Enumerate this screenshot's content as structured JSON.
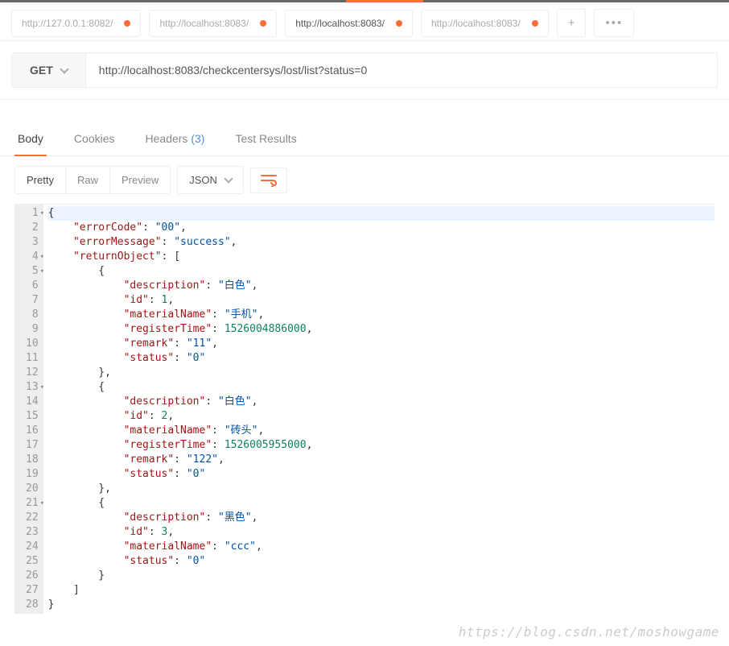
{
  "tabs": [
    {
      "label": "http://127.0.0.1:8082/",
      "dirty": true,
      "active": false
    },
    {
      "label": "http://localhost:8083/",
      "dirty": true,
      "active": false
    },
    {
      "label": "http://localhost:8083/",
      "dirty": true,
      "active": true
    },
    {
      "label": "http://localhost:8083/",
      "dirty": true,
      "active": false
    }
  ],
  "request": {
    "method": "GET",
    "url": "http://localhost:8083/checkcentersys/lost/list?status=0"
  },
  "response_tabs": {
    "body": "Body",
    "cookies": "Cookies",
    "headers": "Headers",
    "headers_count": "(3)",
    "test_results": "Test Results"
  },
  "view_toolbar": {
    "pretty": "Pretty",
    "raw": "Raw",
    "preview": "Preview",
    "format": "JSON"
  },
  "response_body": {
    "errorCode": "00",
    "errorMessage": "success",
    "returnObject": [
      {
        "description": "白色",
        "id": 1,
        "materialName": "手机",
        "registerTime": 1526004886000,
        "remark": "11",
        "status": "0"
      },
      {
        "description": "白色",
        "id": 2,
        "materialName": "砖头",
        "registerTime": 1526005955000,
        "remark": "122",
        "status": "0"
      },
      {
        "description": "黑色",
        "id": 3,
        "materialName": "ccc",
        "status": "0"
      }
    ]
  },
  "code_lines": [
    {
      "num": 1,
      "fold": true,
      "indent": 0,
      "tokens": [
        [
          "pun",
          "{"
        ]
      ],
      "hl": true
    },
    {
      "num": 2,
      "fold": false,
      "indent": 1,
      "tokens": [
        [
          "key",
          "\"errorCode\""
        ],
        [
          "pun",
          ": "
        ],
        [
          "str",
          "\"00\""
        ],
        [
          "pun",
          ","
        ]
      ]
    },
    {
      "num": 3,
      "fold": false,
      "indent": 1,
      "tokens": [
        [
          "key",
          "\"errorMessage\""
        ],
        [
          "pun",
          ": "
        ],
        [
          "str",
          "\"success\""
        ],
        [
          "pun",
          ","
        ]
      ]
    },
    {
      "num": 4,
      "fold": true,
      "indent": 1,
      "tokens": [
        [
          "key",
          "\"returnObject\""
        ],
        [
          "pun",
          ": ["
        ]
      ]
    },
    {
      "num": 5,
      "fold": true,
      "indent": 2,
      "tokens": [
        [
          "pun",
          "{"
        ]
      ]
    },
    {
      "num": 6,
      "fold": false,
      "indent": 3,
      "tokens": [
        [
          "key",
          "\"description\""
        ],
        [
          "pun",
          ": "
        ],
        [
          "str",
          "\"白色\""
        ],
        [
          "pun",
          ","
        ]
      ]
    },
    {
      "num": 7,
      "fold": false,
      "indent": 3,
      "tokens": [
        [
          "key",
          "\"id\""
        ],
        [
          "pun",
          ": "
        ],
        [
          "num",
          "1"
        ],
        [
          "pun",
          ","
        ]
      ]
    },
    {
      "num": 8,
      "fold": false,
      "indent": 3,
      "tokens": [
        [
          "key",
          "\"materialName\""
        ],
        [
          "pun",
          ": "
        ],
        [
          "str",
          "\"手机\""
        ],
        [
          "pun",
          ","
        ]
      ]
    },
    {
      "num": 9,
      "fold": false,
      "indent": 3,
      "tokens": [
        [
          "key",
          "\"registerTime\""
        ],
        [
          "pun",
          ": "
        ],
        [
          "num",
          "1526004886000"
        ],
        [
          "pun",
          ","
        ]
      ]
    },
    {
      "num": 10,
      "fold": false,
      "indent": 3,
      "tokens": [
        [
          "key",
          "\"remark\""
        ],
        [
          "pun",
          ": "
        ],
        [
          "str",
          "\"11\""
        ],
        [
          "pun",
          ","
        ]
      ]
    },
    {
      "num": 11,
      "fold": false,
      "indent": 3,
      "tokens": [
        [
          "key",
          "\"status\""
        ],
        [
          "pun",
          ": "
        ],
        [
          "str",
          "\"0\""
        ]
      ]
    },
    {
      "num": 12,
      "fold": false,
      "indent": 2,
      "tokens": [
        [
          "pun",
          "},"
        ]
      ]
    },
    {
      "num": 13,
      "fold": true,
      "indent": 2,
      "tokens": [
        [
          "pun",
          "{"
        ]
      ]
    },
    {
      "num": 14,
      "fold": false,
      "indent": 3,
      "tokens": [
        [
          "key",
          "\"description\""
        ],
        [
          "pun",
          ": "
        ],
        [
          "str",
          "\"白色\""
        ],
        [
          "pun",
          ","
        ]
      ]
    },
    {
      "num": 15,
      "fold": false,
      "indent": 3,
      "tokens": [
        [
          "key",
          "\"id\""
        ],
        [
          "pun",
          ": "
        ],
        [
          "num",
          "2"
        ],
        [
          "pun",
          ","
        ]
      ]
    },
    {
      "num": 16,
      "fold": false,
      "indent": 3,
      "tokens": [
        [
          "key",
          "\"materialName\""
        ],
        [
          "pun",
          ": "
        ],
        [
          "str",
          "\"砖头\""
        ],
        [
          "pun",
          ","
        ]
      ]
    },
    {
      "num": 17,
      "fold": false,
      "indent": 3,
      "tokens": [
        [
          "key",
          "\"registerTime\""
        ],
        [
          "pun",
          ": "
        ],
        [
          "num",
          "1526005955000"
        ],
        [
          "pun",
          ","
        ]
      ]
    },
    {
      "num": 18,
      "fold": false,
      "indent": 3,
      "tokens": [
        [
          "key",
          "\"remark\""
        ],
        [
          "pun",
          ": "
        ],
        [
          "str",
          "\"122\""
        ],
        [
          "pun",
          ","
        ]
      ]
    },
    {
      "num": 19,
      "fold": false,
      "indent": 3,
      "tokens": [
        [
          "key",
          "\"status\""
        ],
        [
          "pun",
          ": "
        ],
        [
          "str",
          "\"0\""
        ]
      ]
    },
    {
      "num": 20,
      "fold": false,
      "indent": 2,
      "tokens": [
        [
          "pun",
          "},"
        ]
      ]
    },
    {
      "num": 21,
      "fold": true,
      "indent": 2,
      "tokens": [
        [
          "pun",
          "{"
        ]
      ]
    },
    {
      "num": 22,
      "fold": false,
      "indent": 3,
      "tokens": [
        [
          "key",
          "\"description\""
        ],
        [
          "pun",
          ": "
        ],
        [
          "str",
          "\"黑色\""
        ],
        [
          "pun",
          ","
        ]
      ]
    },
    {
      "num": 23,
      "fold": false,
      "indent": 3,
      "tokens": [
        [
          "key",
          "\"id\""
        ],
        [
          "pun",
          ": "
        ],
        [
          "num",
          "3"
        ],
        [
          "pun",
          ","
        ]
      ]
    },
    {
      "num": 24,
      "fold": false,
      "indent": 3,
      "tokens": [
        [
          "key",
          "\"materialName\""
        ],
        [
          "pun",
          ": "
        ],
        [
          "str",
          "\"ccc\""
        ],
        [
          "pun",
          ","
        ]
      ]
    },
    {
      "num": 25,
      "fold": false,
      "indent": 3,
      "tokens": [
        [
          "key",
          "\"status\""
        ],
        [
          "pun",
          ": "
        ],
        [
          "str",
          "\"0\""
        ]
      ]
    },
    {
      "num": 26,
      "fold": false,
      "indent": 2,
      "tokens": [
        [
          "pun",
          "}"
        ]
      ]
    },
    {
      "num": 27,
      "fold": false,
      "indent": 1,
      "tokens": [
        [
          "pun",
          "]"
        ]
      ]
    },
    {
      "num": 28,
      "fold": false,
      "indent": 0,
      "tokens": [
        [
          "pun",
          "}"
        ]
      ]
    }
  ],
  "watermark": "https://blog.csdn.net/moshowgame"
}
